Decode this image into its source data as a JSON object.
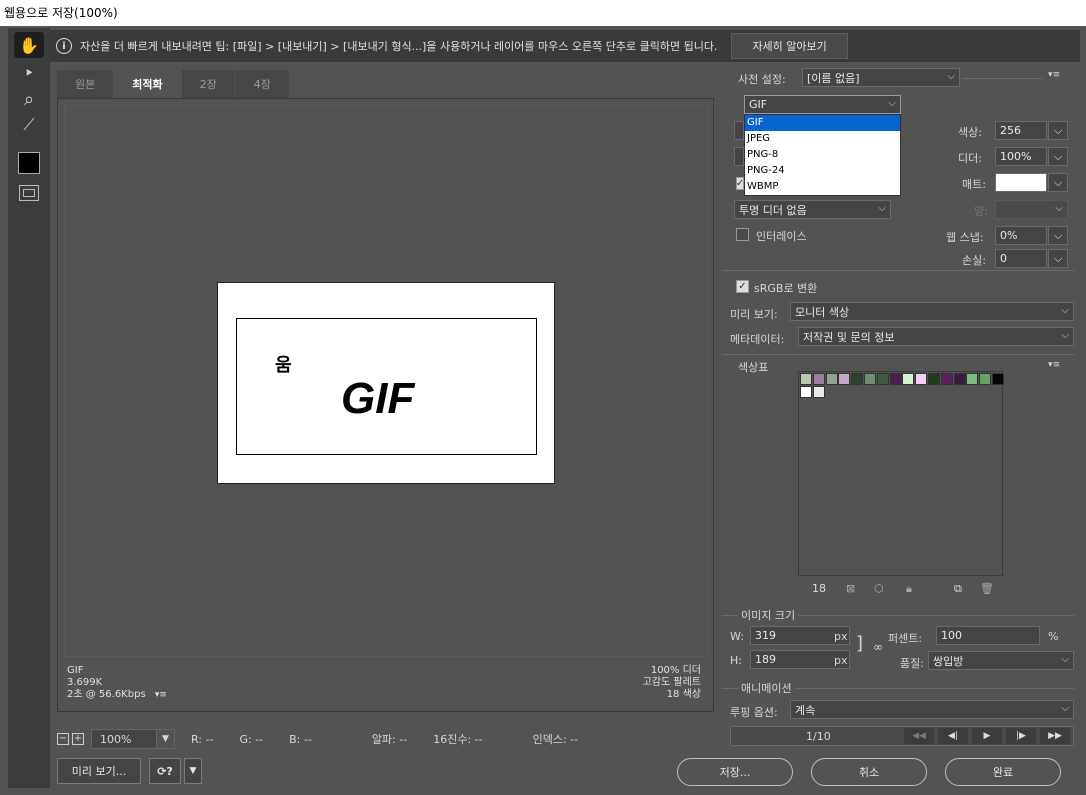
{
  "window": {
    "title": "웹용으로 저장(100%)"
  },
  "tools": [
    {
      "name": "hand-tool",
      "glyph": "✋",
      "active": true
    },
    {
      "name": "slice-select-tool",
      "glyph": "⯈"
    },
    {
      "name": "zoom-tool",
      "glyph": "⌕"
    },
    {
      "name": "eyedropper-tool",
      "glyph": "⟋"
    }
  ],
  "tip": {
    "text": "자산을 더 빠르게 내보내려면 팁: [파일] > [내보내기] > [내보내기 형식...]을 사용하거나 레이어를 마우스 오른쪽 단추로 클릭하면 됩니다.",
    "learn_more": "자세히 알아보기"
  },
  "tabs": [
    "원본",
    "최적화",
    "2장",
    "4장"
  ],
  "active_tab": 1,
  "preview": {
    "small_text": "움",
    "big_text": "GIF"
  },
  "info_left": [
    "GIF",
    "3.699K",
    "2초 @ 56.6Kbps"
  ],
  "info_right": [
    "100% 디더",
    "고감도 팔레트",
    "18 색상"
  ],
  "status": {
    "zoom": "100%",
    "r": "R: --",
    "g": "G: --",
    "b": "B: --",
    "alpha": "알파: --",
    "hex": "16진수: --",
    "index": "인덱스: --"
  },
  "buttons": {
    "preview": "미리 보기...",
    "save": "저장...",
    "cancel": "취소",
    "done": "완료"
  },
  "settings": {
    "preset_label": "사전 설정:",
    "preset_value": "[이름 없음]",
    "format_value": "GIF",
    "format_options": [
      "GIF",
      "JPEG",
      "PNG-8",
      "PNG-24",
      "WBMP"
    ],
    "selected_format": 0,
    "colors_label": "색상:",
    "colors_value": "256",
    "dither_label": "디더:",
    "dither_value": "100%",
    "matte_label": "매트:",
    "amount_label": "양:",
    "transparency_dither": "투명 디더 없음",
    "interlace_label": "인터레이스",
    "web_snap_label": "웹 스냅:",
    "web_snap_value": "0%",
    "lossy_label": "손실:",
    "lossy_value": "0",
    "srgb_label": "sRGB로 변환",
    "preview_label": "미리 보기:",
    "preview_value": "모니터 색상",
    "metadata_label": "메타데이터:",
    "metadata_value": "저작권 및 문의 정보"
  },
  "color_table": {
    "title": "색상표",
    "count": "18"
  },
  "swatch_colors": [
    "#b9c6b4",
    "#9c7f9d",
    "#8fa591",
    "#c6a7c4",
    "#314031",
    "#6e8f70",
    "#3f5b40",
    "#4c1f4c",
    "#d3f3d3",
    "#f3cef3",
    "#1f3a1f",
    "#5b1f5b",
    "#3b1a3b",
    "#7bbb7b",
    "#62a562",
    "#050505",
    "#ffffff",
    "#e8e8e8"
  ],
  "image_size": {
    "title": "이미지 크기",
    "w_label": "W:",
    "w_value": "319",
    "h_label": "H:",
    "h_value": "189",
    "unit": "px",
    "percent_label": "퍼센트:",
    "percent_value": "100",
    "percent_unit": "%",
    "quality_label": "품질:",
    "quality_value": "쌍입방"
  },
  "animation": {
    "title": "애니메이션",
    "loop_label": "루핑 옵션:",
    "loop_value": "계속",
    "frame": "1/10"
  }
}
